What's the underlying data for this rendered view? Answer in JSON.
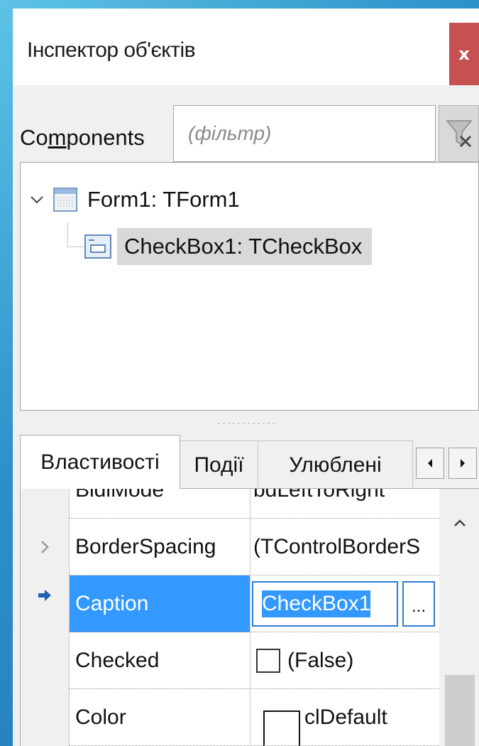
{
  "window": {
    "title": "Інспектор об'єктів",
    "close_label": "x"
  },
  "components": {
    "label_before": "Co",
    "label_underlined": "m",
    "label_after": "ponents",
    "filter_placeholder": "(фільтр)"
  },
  "tree": {
    "items": [
      {
        "label": "Form1: TForm1",
        "expanded": true,
        "icon": "form-icon"
      },
      {
        "label": "CheckBox1: TCheckBox",
        "selected": true,
        "icon": "checkbox-component-icon"
      }
    ]
  },
  "tabs": [
    {
      "label": "Властивості",
      "active": true
    },
    {
      "label": "Події",
      "active": false
    },
    {
      "label": "Улюблені",
      "active": false
    }
  ],
  "properties": [
    {
      "name": "BidiMode",
      "value": "bdLeftToRight"
    },
    {
      "name": "BorderSpacing",
      "value": "(TControlBorderS",
      "expandable": true
    },
    {
      "name": "Caption",
      "value": "CheckBox1",
      "selected": true,
      "editor_button": "..."
    },
    {
      "name": "Checked",
      "value": "(False)",
      "checkbox_checked": false
    },
    {
      "name": "Color",
      "value": "clDefault"
    }
  ],
  "colors": {
    "selection_blue": "#3399ff",
    "close_red": "#c75050",
    "tree_selection": "#d9d9d9"
  }
}
